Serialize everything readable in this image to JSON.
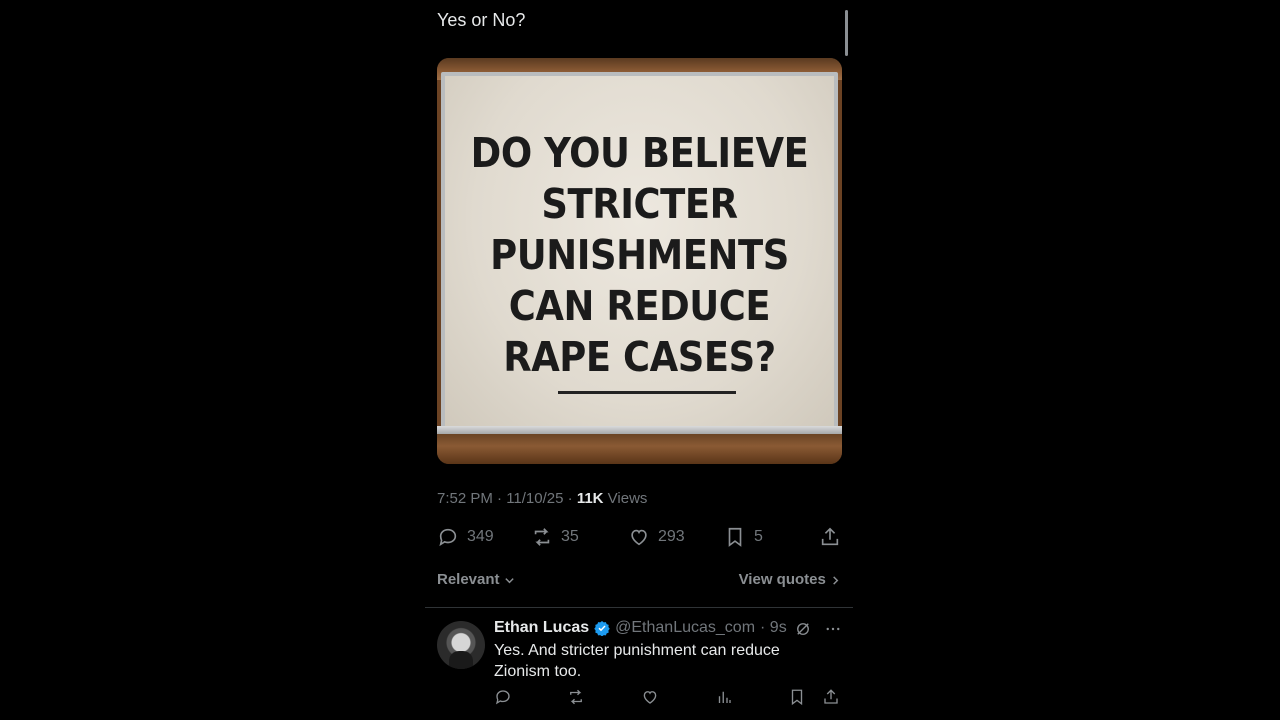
{
  "tweet": {
    "text": "Yes or No?",
    "image_text_lines": [
      "DO YOU BELIEVE",
      "STRICTER",
      "PUNISHMENTS",
      "CAN REDUCE",
      "RAPE CASES?"
    ],
    "time": "7:52 PM · 11/10/25 · ",
    "views_count": "11K",
    "views_label": " Views"
  },
  "actions": {
    "replies": "349",
    "retweets": "35",
    "likes": "293",
    "bookmarks": "5"
  },
  "sort": {
    "relevant_label": "Relevant",
    "view_quotes_label": "View quotes"
  },
  "reply": {
    "name": "Ethan Lucas",
    "handle": "@EthanLucas_com",
    "time": "· 9s",
    "text": "Yes. And stricter punishment can reduce Zionism too."
  },
  "colors": {
    "background": "#000000",
    "text_primary": "#e7e9ea",
    "text_secondary": "#71767b",
    "verified": "#1d9bf0"
  }
}
